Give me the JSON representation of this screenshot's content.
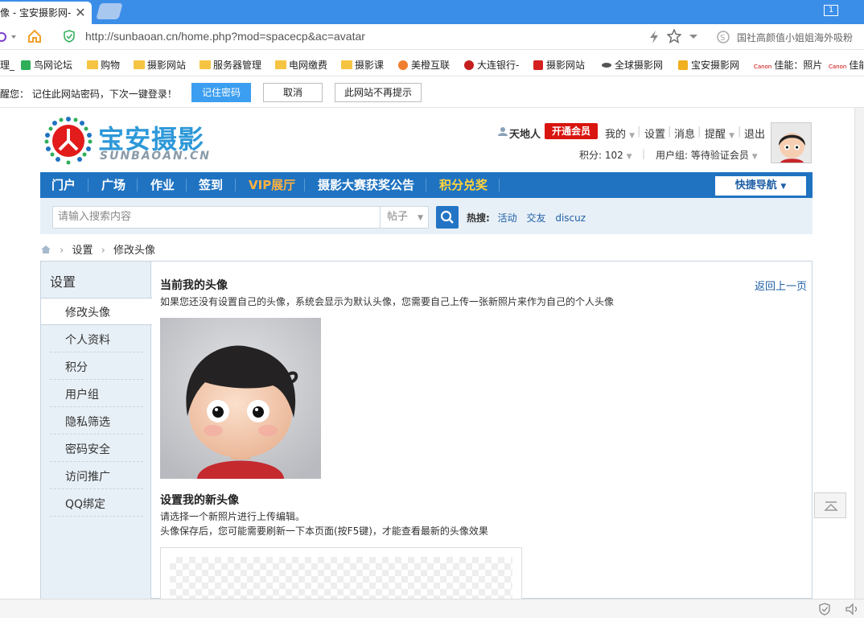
{
  "browser": {
    "tab_title": "像 - 宝安摄影网-",
    "tab_close": "✕",
    "window_badge": "1",
    "url": "http://sunbaoan.cn/home.php?mod=spacecp&ac=avatar",
    "addr_right_text": "国社高颜值小姐姐海外吸粉",
    "bookmarks": [
      "鸟网论坛",
      "购物",
      "摄影网站",
      "服务器管理",
      "电网缴费",
      "摄影课",
      "美橙互联",
      "大连银行-",
      "摄影网站",
      "全球摄影网",
      "宝安摄影网",
      "佳能：照片",
      "佳能"
    ],
    "bookmark_edge": "理_"
  },
  "password_bar": {
    "message": "醒您：  记住此网站密码，下次一键登录！",
    "remember_label": "记住密码",
    "cancel_label": "取消",
    "never_label": "此网站不再提示"
  },
  "site": {
    "logo_text": "宝安摄影",
    "logo_sub": "SUNBAOAN.CN"
  },
  "user": {
    "name": "天地人",
    "vip_label": "开通会员",
    "links": [
      "我的",
      "设置",
      "消息",
      "提醒",
      "退出"
    ],
    "points": "积分: 102",
    "group": "用户组: 等待验证会员"
  },
  "nav": {
    "items": [
      "门户",
      "广场",
      "作业",
      "签到",
      "VIP展厅",
      "摄影大赛获奖公告",
      "积分兑奖"
    ],
    "quick_nav": "快捷导航"
  },
  "search": {
    "placeholder": "请输入搜索内容",
    "type": "帖子",
    "hot_label": "热搜:",
    "hot_items": [
      "活动",
      "交友",
      "discuz"
    ]
  },
  "breadcrumb": [
    "设置",
    "修改头像"
  ],
  "sidebar": {
    "title": "设置",
    "items": [
      "修改头像",
      "个人资料",
      "积分",
      "用户组",
      "隐私筛选",
      "密码安全",
      "访问推广",
      "QQ绑定"
    ]
  },
  "main": {
    "current_title": "当前我的头像",
    "current_desc": "如果您还没有设置自己的头像，系统会显示为默认头像，您需要自己上传一张新照片来作为自己的个人头像",
    "back_link": "返回上一页",
    "new_title": "设置我的新头像",
    "new_desc1": "请选择一个新照片进行上传编辑。",
    "new_desc2": "头像保存后，您可能需要刷新一下本页面(按F5键)，才能查看最新的头像效果"
  },
  "colors": {
    "nav_bg": "#1f73c1",
    "tabbar_bg": "#3b8ee8",
    "vip_red": "#d9150f",
    "link_blue": "#1f5fa5"
  }
}
